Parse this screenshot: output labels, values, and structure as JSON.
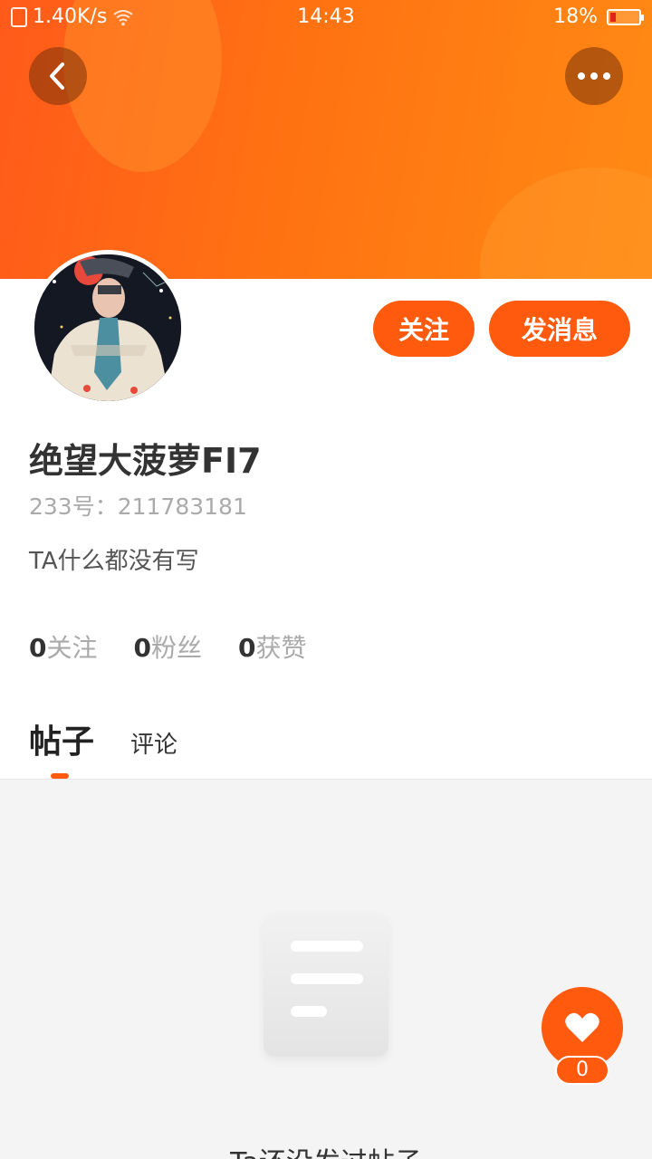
{
  "status_bar": {
    "net_speed": "1.40K/s",
    "time": "14:43",
    "battery": "18%"
  },
  "header": {
    "back_icon": "chevron-left-icon",
    "more_icon": "more-dots-icon"
  },
  "profile": {
    "username": "绝望大菠萝FI7",
    "id_text": "233号：211783181",
    "bio": "TA什么都没有写",
    "follow_label": "关注",
    "message_label": "发消息"
  },
  "stats": [
    {
      "num": "0",
      "label": "关注"
    },
    {
      "num": "0",
      "label": "粉丝"
    },
    {
      "num": "0",
      "label": "获赞"
    }
  ],
  "tabs": [
    {
      "label": "帖子",
      "active": true
    },
    {
      "label": "评论",
      "active": false
    }
  ],
  "empty_state": {
    "text": "Ta还没发过帖子"
  },
  "like": {
    "count": "0"
  },
  "colors": {
    "accent": "#ff5a0e",
    "banner_start": "#ff5a1a",
    "banner_end": "#ff8a14"
  }
}
